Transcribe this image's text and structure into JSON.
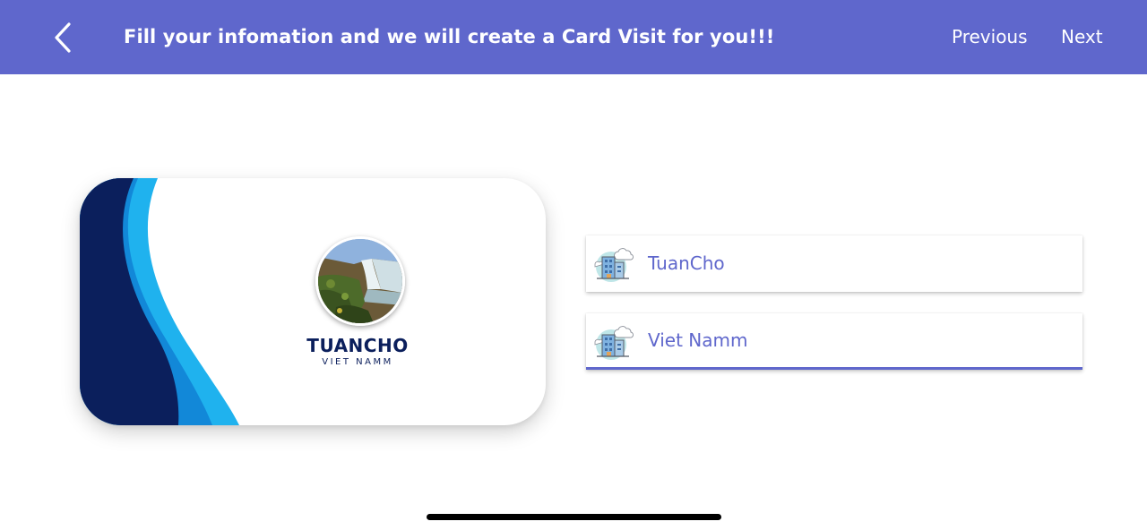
{
  "header": {
    "title": "Fill your infomation and we will create a Card Visit for you!!!",
    "previous_label": "Previous",
    "next_label": "Next",
    "back_icon": "chevron-left-icon",
    "background_color": "#5f67cc"
  },
  "card": {
    "name": "TUANCHO",
    "subtitle": "VIET NAMM",
    "avatar": "waterfall-photo",
    "colors": {
      "navy": "#0b1f5c",
      "blue": "#1599e0",
      "light_blue": "#1fb2ee"
    }
  },
  "fields": [
    {
      "icon": "building-icon",
      "value": "TuanCho"
    },
    {
      "icon": "building-icon",
      "value": "Viet Namm"
    }
  ],
  "accent_color": "#5f67cc"
}
